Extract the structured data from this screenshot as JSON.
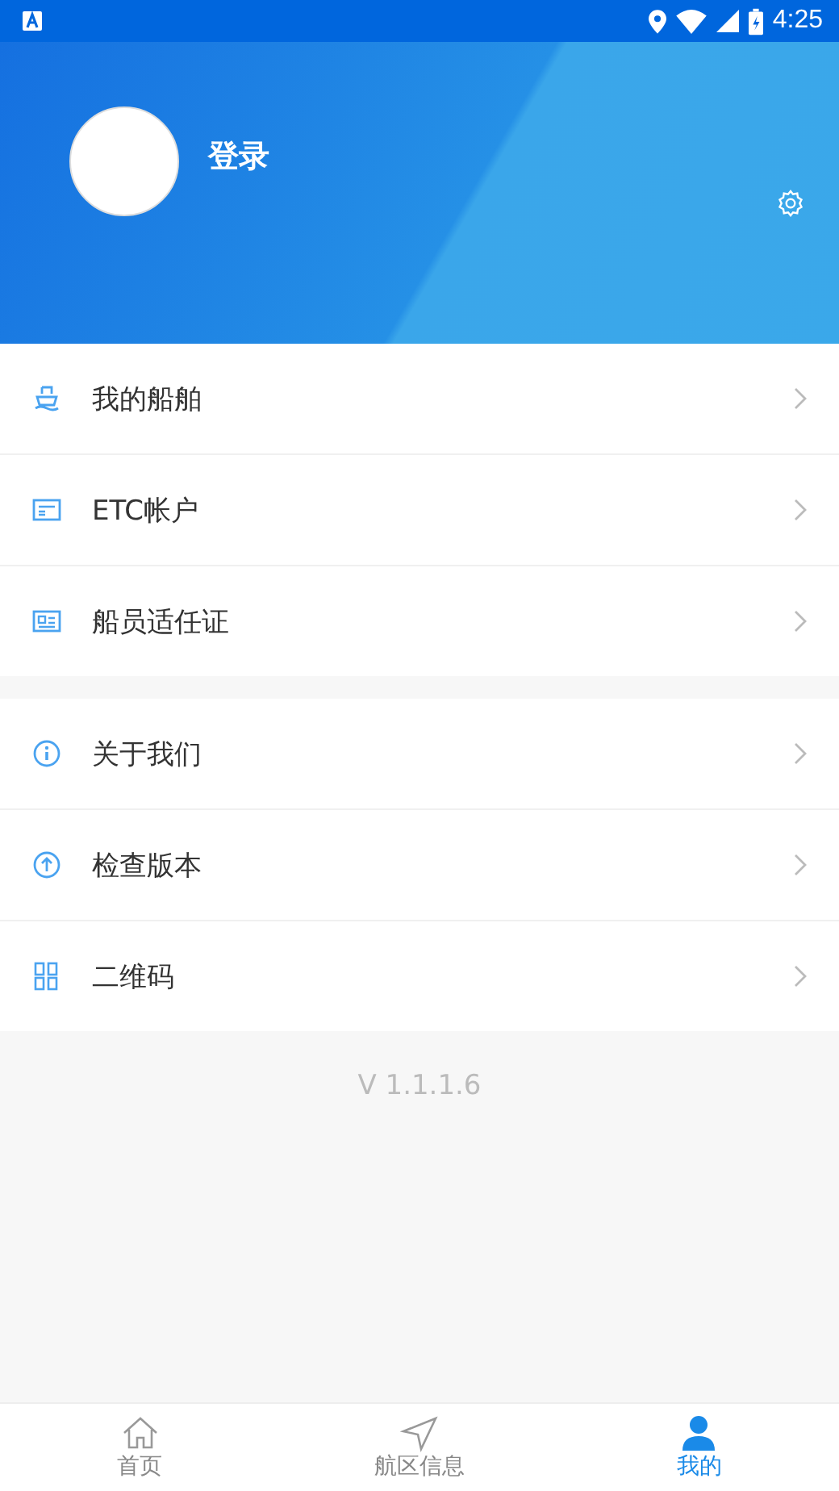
{
  "status_bar": {
    "time": "4:25"
  },
  "profile": {
    "login_label": "登录"
  },
  "menu_groups": [
    {
      "items": [
        {
          "label": "我的船舶"
        },
        {
          "label": "ETC帐户"
        },
        {
          "label": "船员适任证"
        }
      ]
    },
    {
      "items": [
        {
          "label": "关于我们"
        },
        {
          "label": "检查版本"
        },
        {
          "label": "二维码"
        }
      ]
    }
  ],
  "version": "V 1.1.1.6",
  "bottom_tabs": [
    {
      "label": "首页",
      "selected": false
    },
    {
      "label": "航区信息",
      "selected": false
    },
    {
      "label": "我的",
      "selected": true
    }
  ]
}
